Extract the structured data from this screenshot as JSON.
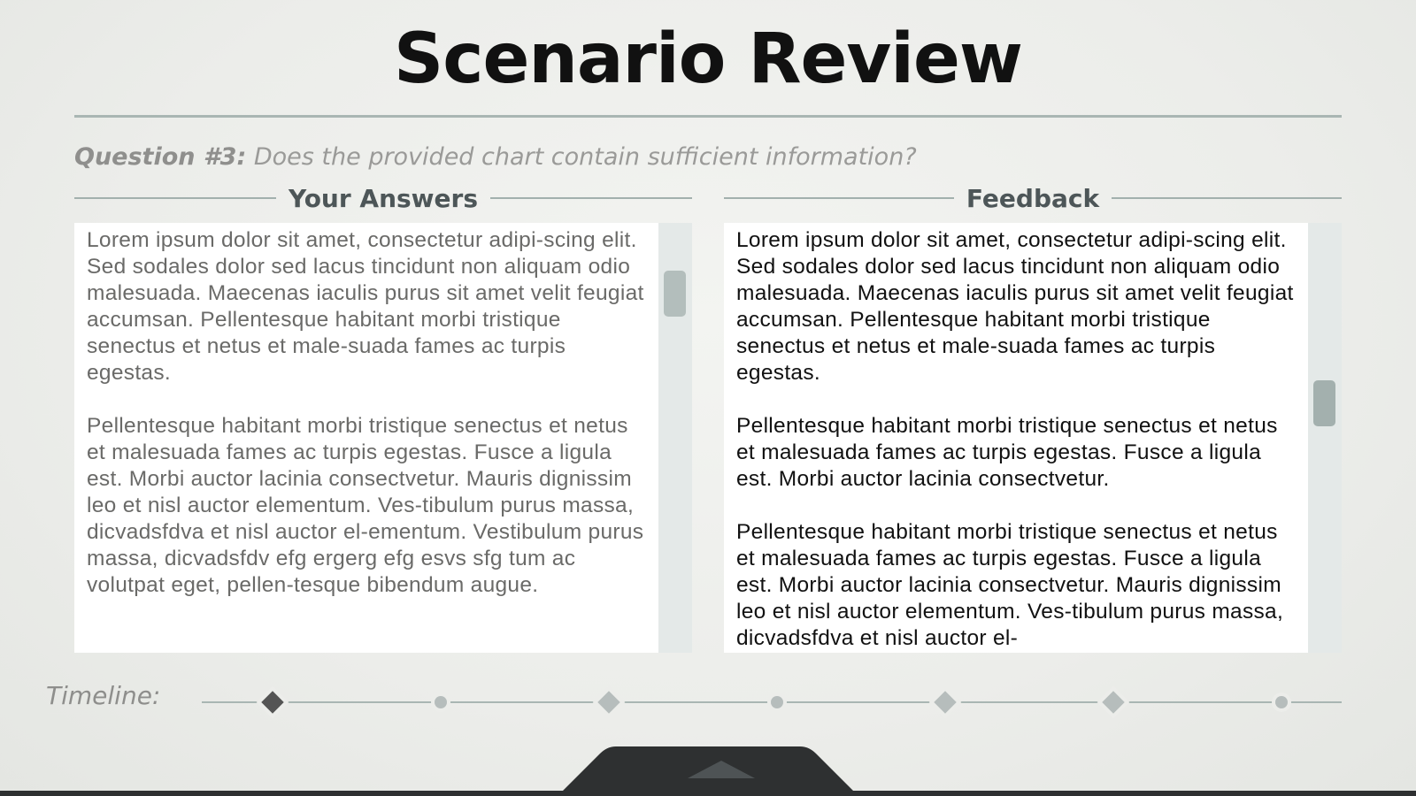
{
  "page": {
    "title": "Scenario Review"
  },
  "question": {
    "number_label": "Question #3:",
    "text": "Does the provided chart contain sufficient information?"
  },
  "answers_panel": {
    "heading": "Your Answers",
    "paragraphs": [
      "Lorem ipsum dolor sit amet, consectetur adipi-scing elit. Sed sodales dolor sed lacus tincidunt non aliquam odio malesuada. Maecenas iaculis purus sit amet velit feugiat accumsan. Pellentesque habitant morbi tristique senectus et netus et male-suada fames ac turpis egestas.",
      "Pellentesque habitant morbi tristique senectus et netus et malesuada fames ac turpis egestas. Fusce a ligula est. Morbi auctor lacinia consectvetur. Mauris dignissim leo et nisl auctor elementum. Ves-tibulum purus massa, dicvadsfdva  et nisl auctor el-ementum. Vestibulum purus massa, dicvadsfdv efg ergerg efg esvs sfg tum ac volutpat eget, pellen-tesque bibendum augue."
    ]
  },
  "feedback_panel": {
    "heading": "Feedback",
    "paragraphs": [
      "Lorem ipsum dolor sit amet, consectetur adipi-scing elit. Sed sodales dolor sed lacus tincidunt non aliquam odio malesuada. Maecenas iaculis purus sit amet velit feugiat accumsan. Pellentesque habitant morbi tristique senectus et netus et male-suada fames ac turpis egestas.",
      "Pellentesque habitant morbi tristique senectus et netus et malesuada fames ac turpis egestas. Fusce a ligula est. Morbi auctor lacinia consectvetur.",
      "Pellentesque habitant morbi tristique senectus et netus et malesuada fames ac turpis egestas. Fusce a ligula est. Morbi auctor lacinia consectvetur. Mauris dignissim leo et nisl auctor elementum. Ves-tibulum purus massa, dicvadsfdva  et nisl auctor el-"
    ]
  },
  "timeline": {
    "label": "Timeline:",
    "markers": [
      {
        "shape": "diamond",
        "state": "active"
      },
      {
        "shape": "dot",
        "state": "inactive"
      },
      {
        "shape": "diamond",
        "state": "inactive"
      },
      {
        "shape": "dot",
        "state": "inactive"
      },
      {
        "shape": "diamond",
        "state": "inactive"
      },
      {
        "shape": "diamond",
        "state": "inactive"
      },
      {
        "shape": "dot",
        "state": "inactive"
      }
    ]
  },
  "drawer": {
    "icon": "chevron-up-icon"
  },
  "colors": {
    "background": "#ecedea",
    "rule": "#a9b6b3",
    "scroll_thumb": "#a3b0ae",
    "drawer": "#2e3031"
  }
}
